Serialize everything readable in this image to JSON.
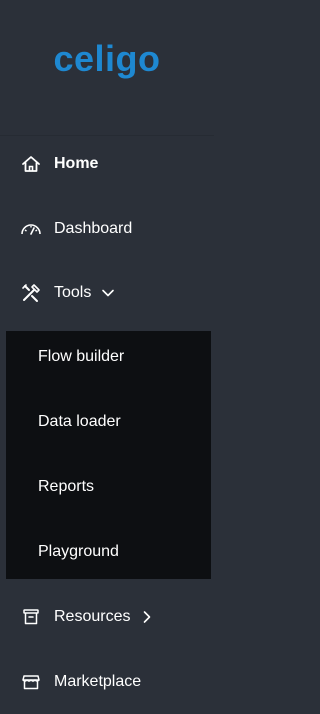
{
  "brand": {
    "logo_text": "celigo",
    "color": "#1e88d1"
  },
  "nav": {
    "items": [
      {
        "label": "Home",
        "icon": "home-icon"
      },
      {
        "label": "Dashboard",
        "icon": "gauge-icon"
      },
      {
        "label": "Tools",
        "icon": "tools-icon",
        "expanded": true
      },
      {
        "label": "Resources",
        "icon": "archive-box-icon",
        "expanded": false
      },
      {
        "label": "Marketplace",
        "icon": "storefront-icon"
      }
    ],
    "tools_submenu": [
      {
        "label": "Flow builder"
      },
      {
        "label": "Data loader"
      },
      {
        "label": "Reports"
      },
      {
        "label": "Playground"
      }
    ]
  },
  "colors": {
    "sidebar_bg": "#2b3039",
    "submenu_bg": "#0d0f12",
    "text": "#ffffff"
  }
}
